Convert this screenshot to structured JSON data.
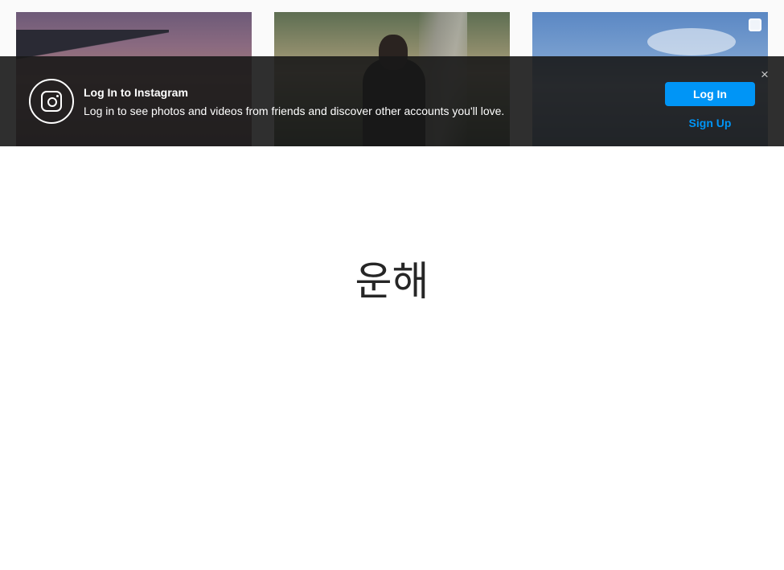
{
  "banner": {
    "title": "Log In to Instagram",
    "subtitle": "Log in to see photos and videos from friends and discover other accounts you'll love.",
    "login_label": "Log In",
    "signup_label": "Sign Up",
    "close_glyph": "×",
    "accent_color": "#0095f6"
  },
  "main": {
    "text": "운해"
  },
  "icons": {
    "logo": "instagram-logo-icon",
    "multi_post": "multi-post-icon",
    "close": "close-icon"
  }
}
